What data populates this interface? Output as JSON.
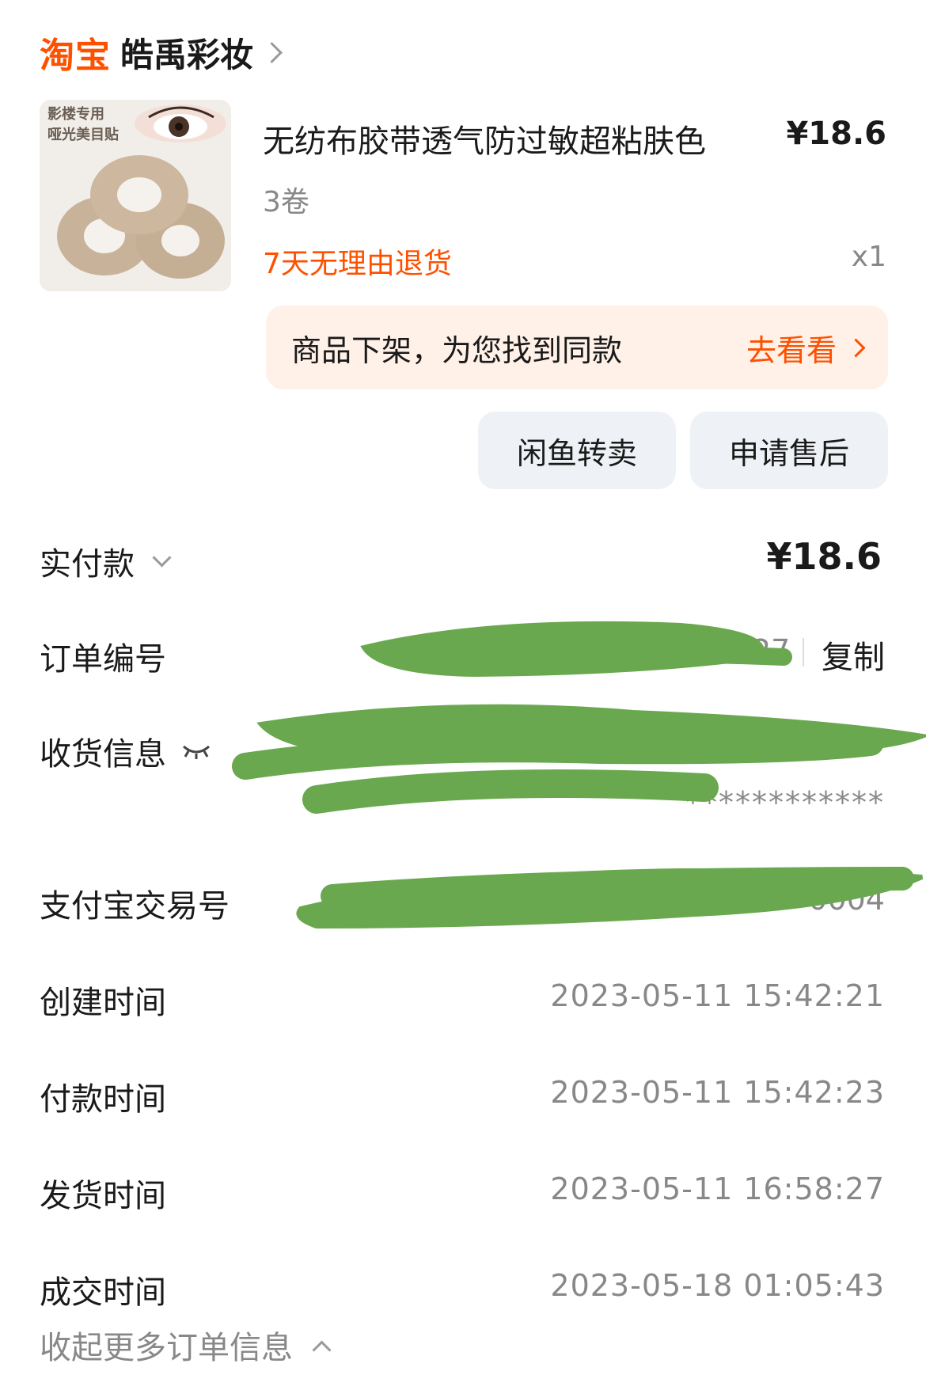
{
  "shop": {
    "platform": "淘宝",
    "name": "皓禹彩妆"
  },
  "product": {
    "thumb_text_line1": "影楼专用",
    "thumb_text_line2": "哑光美目贴",
    "name": "无纺布胶带透气防过敏超粘肤色",
    "price": "¥18.6",
    "spec": "3卷",
    "tag": "7天无理由退货",
    "quantity": "x1"
  },
  "banner": {
    "text": "商品下架，为您找到同款",
    "link": "去看看"
  },
  "buttons": {
    "resell": "闲鱼转卖",
    "after_sales": "申请售后"
  },
  "order": {
    "paid_label": "实付款",
    "paid_value": "¥18.6",
    "order_no_label": "订单编号",
    "order_no_partial": "27",
    "copy_label": "复制",
    "shipping_label": "收货信息",
    "shipping_partial": "************",
    "alipay_label": "支付宝交易号",
    "alipay_partial": "0004",
    "created_label": "创建时间",
    "created_value": "2023-05-11 15:42:21",
    "paid_time_label": "付款时间",
    "paid_time_value": "2023-05-11 15:42:23",
    "shipped_label": "发货时间",
    "shipped_value": "2023-05-11 16:58:27",
    "closed_label": "成交时间",
    "closed_value": "2023-05-18 01:05:43",
    "collapse_label": "收起更多订单信息"
  },
  "colors": {
    "accent": "#ff5000",
    "banner_bg": "#fff1e8",
    "button_bg": "#eef2f6",
    "redaction": "#6aa84f"
  }
}
